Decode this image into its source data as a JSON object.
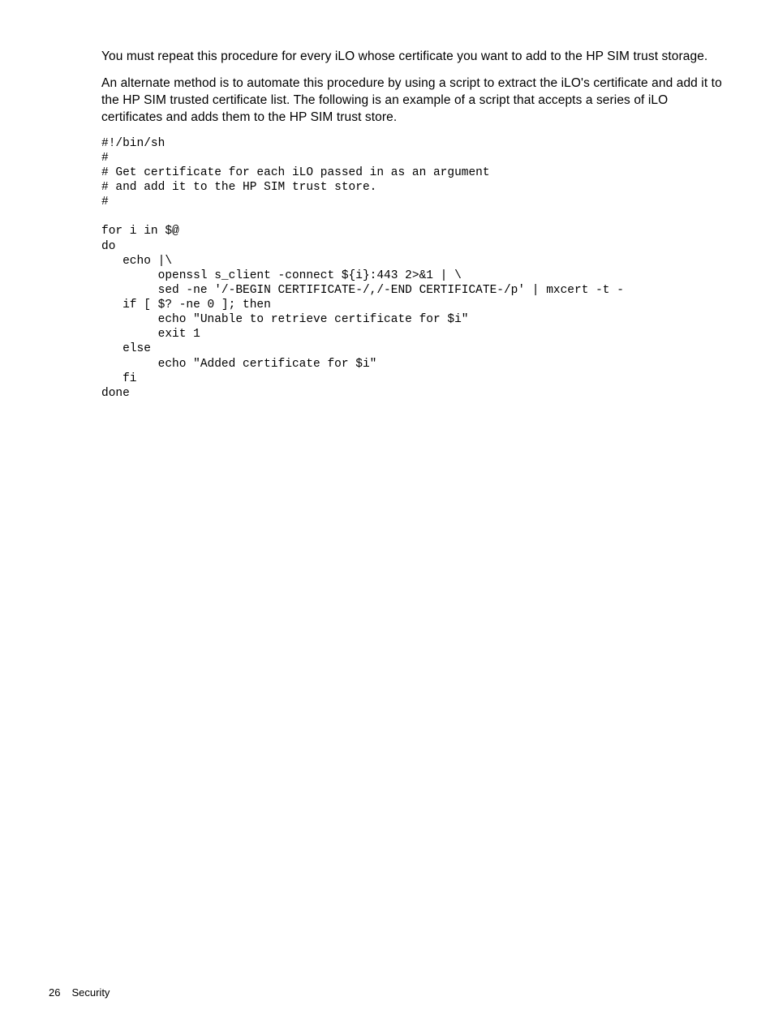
{
  "paragraphs": {
    "p1": "You must repeat this procedure for every iLO whose certificate you want to add to the HP SIM trust storage.",
    "p2": "An alternate method is to automate this procedure by using a script to extract the iLO's certificate and add it to the HP SIM trusted certificate list. The following is an example of a script that accepts a series of iLO certificates and adds them to the HP SIM trust store."
  },
  "code": "#!/bin/sh\n#\n# Get certificate for each iLO passed in as an argument\n# and add it to the HP SIM trust store.\n#\n\nfor i in $@\ndo\n   echo |\\\n        openssl s_client -connect ${i}:443 2>&1 | \\\n        sed -ne '/-BEGIN CERTIFICATE-/,/-END CERTIFICATE-/p' | mxcert -t -\n   if [ $? -ne 0 ]; then\n        echo \"Unable to retrieve certificate for $i\"\n        exit 1\n   else\n        echo \"Added certificate for $i\"\n   fi\ndone",
  "footer": {
    "page_number": "26",
    "section": "Security"
  }
}
